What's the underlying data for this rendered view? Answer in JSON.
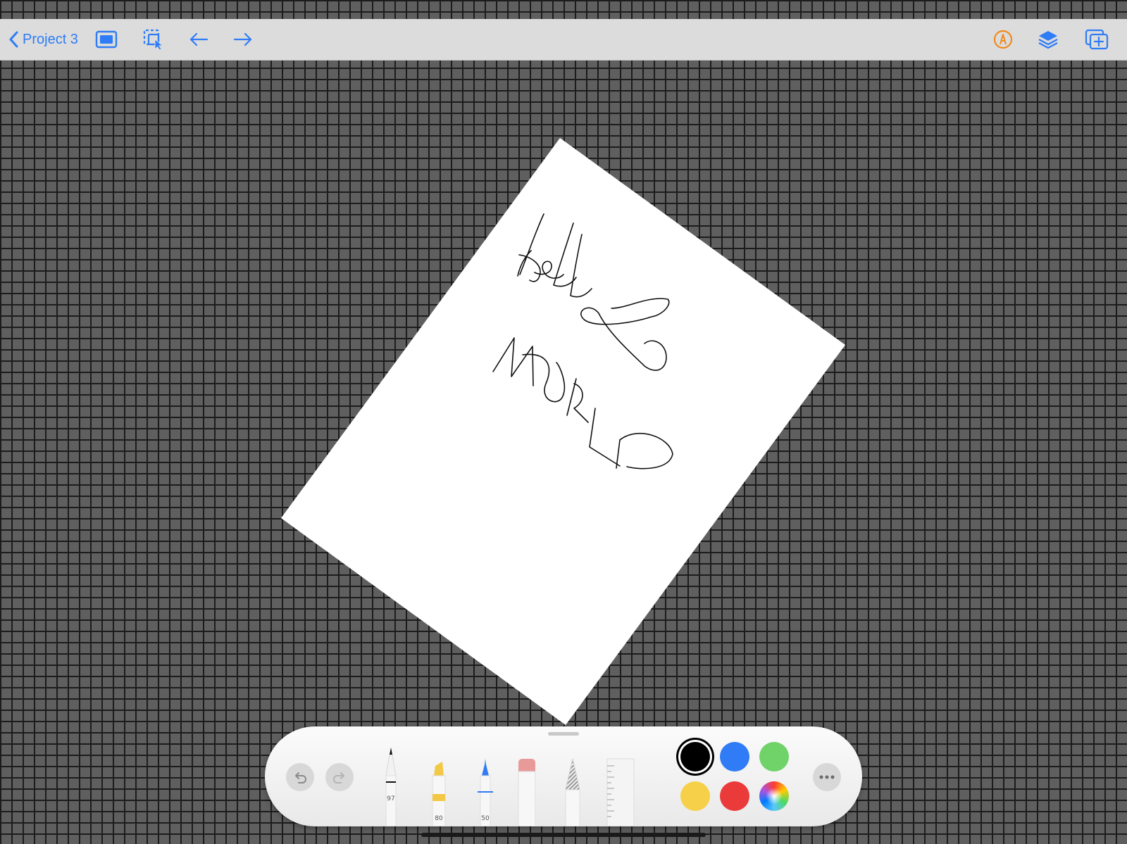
{
  "toolbar": {
    "back_label": "Project 3",
    "icons": [
      "chevron-left-icon",
      "presentation-icon",
      "selection-icon",
      "arrow-left-icon",
      "arrow-right-icon",
      "pencil-circle-icon",
      "layers-icon",
      "add-page-icon"
    ],
    "accent_color": "#2f7cf6",
    "markup_color": "#f08a1c"
  },
  "canvas": {
    "background_color": "#5f5f5f",
    "grid_color": "#1c1c1c",
    "page_color": "#ffffff",
    "handwriting": "hello WORLD"
  },
  "palette": {
    "undo_icon": "undo-icon",
    "redo_icon": "redo-icon",
    "tools": [
      {
        "name": "pen",
        "value": "97",
        "tip_color": "#111111"
      },
      {
        "name": "highlighter",
        "value": "80",
        "tip_color": "#f3c844"
      },
      {
        "name": "marker",
        "value": "50",
        "tip_color": "#2f7cf6"
      },
      {
        "name": "eraser",
        "value": "",
        "tip_color": "#e89a9a"
      },
      {
        "name": "pencil",
        "value": "",
        "tip_color": "#9a9a9a"
      },
      {
        "name": "ruler",
        "value": "",
        "tip_color": "#ffffff"
      }
    ],
    "colors": [
      "#000000",
      "#2f7cf6",
      "#6fd36a",
      "#f7d04a",
      "#ea3a3a",
      "color-wheel"
    ],
    "selected_color": "#000000",
    "more_icon": "ellipsis-icon"
  }
}
